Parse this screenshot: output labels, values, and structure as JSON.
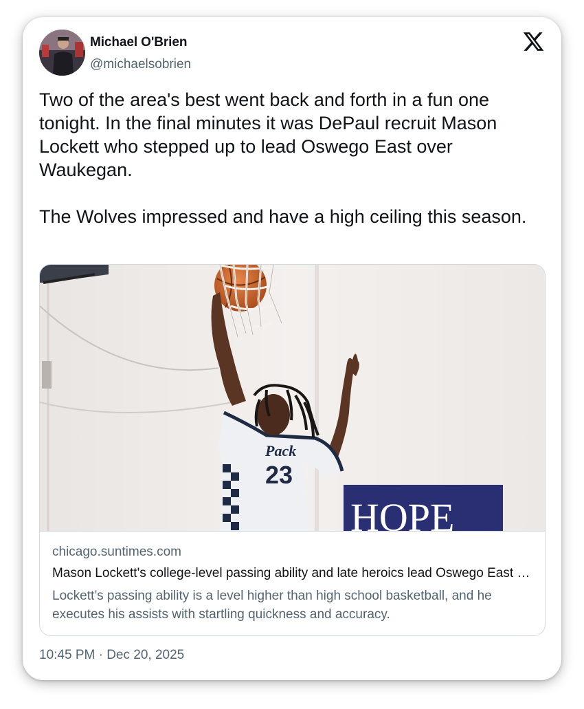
{
  "author": {
    "display_name": "Michael O'Brien",
    "handle": "@michaelsobrien"
  },
  "tweet": {
    "text": "Two of the area's best went back and forth in a fun one tonight. In the final minutes it was DePaul recruit Mason Lockett who stepped up to lead Oswego East over Waukegan.\n\nThe Wolves impressed and have a high ceiling this season.",
    "timestamp": "10:45 PM · Dec 20, 2025"
  },
  "link_card": {
    "domain": "chicago.suntimes.com",
    "title": "Mason Lockett's college-level passing ability and late heroics lead Oswego East over Waukegan",
    "description": "Lockett’s passing ability is a level higher than high school basketball, and he executes his assists with startling quickness and accuracy.",
    "image": {
      "jersey_script": "Pack",
      "jersey_number": "23",
      "banner_text": "HOPE"
    }
  },
  "icons": {
    "brand": "x-logo-icon"
  },
  "colors": {
    "text_primary": "#0f1419",
    "text_secondary": "#536471",
    "border": "#cfd9de",
    "banner": "#2a2f74"
  }
}
